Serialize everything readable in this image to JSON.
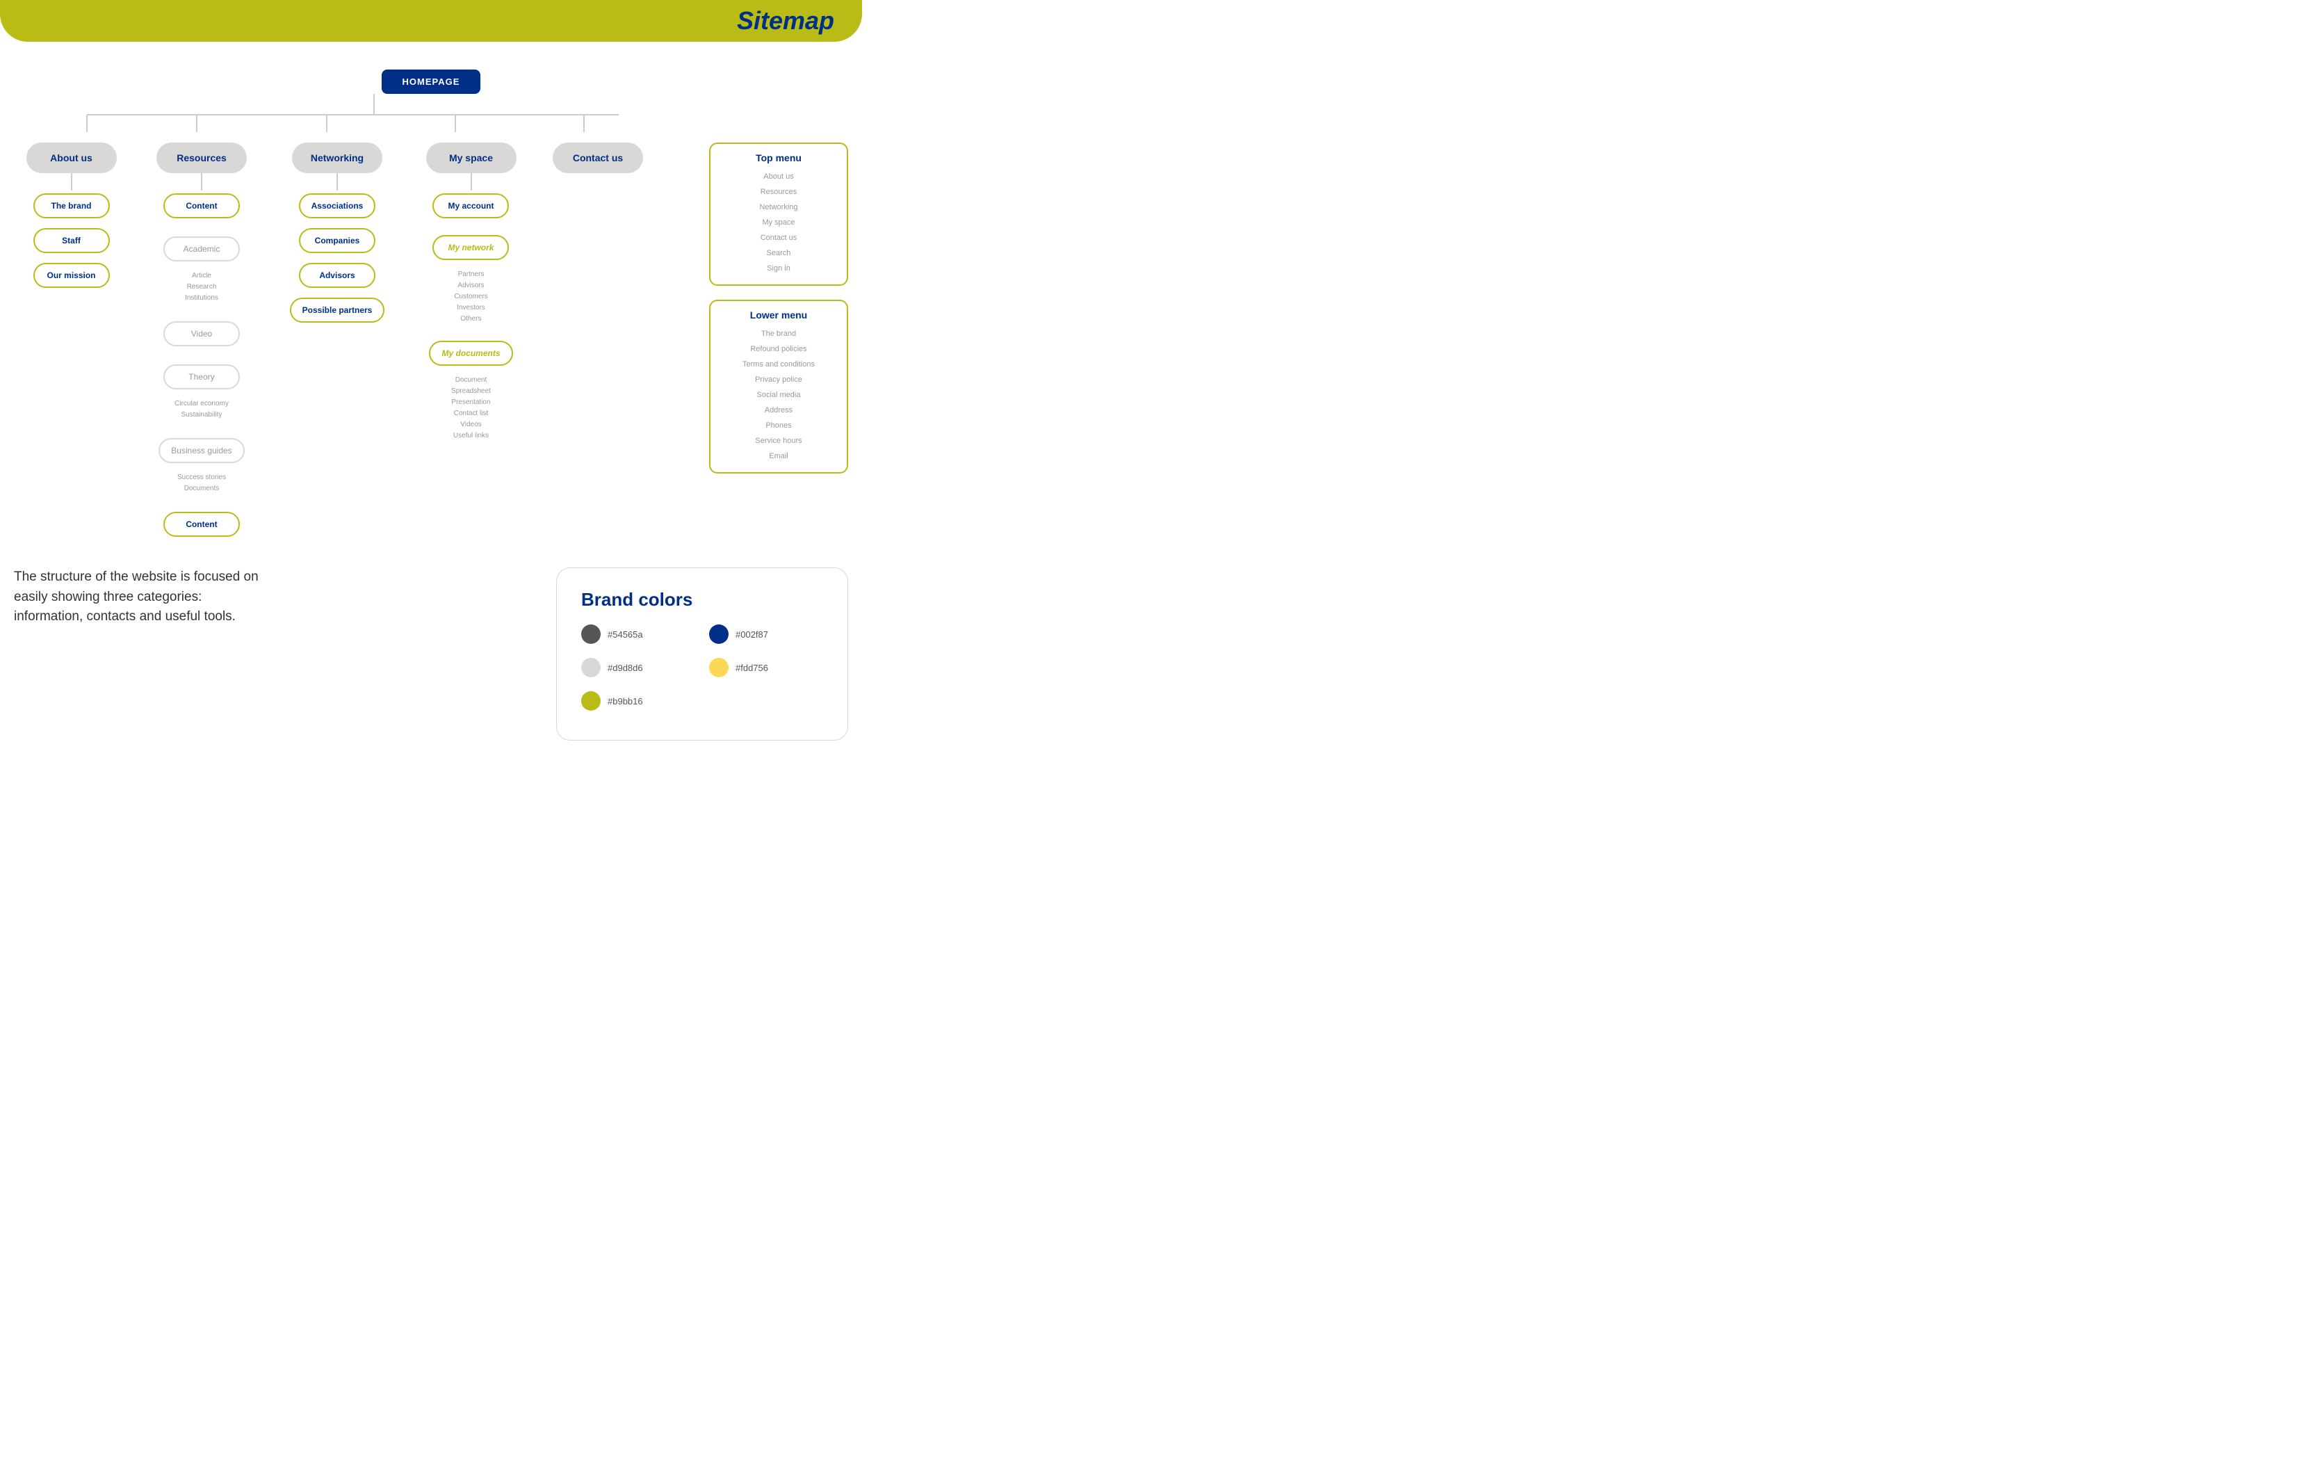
{
  "header": {
    "title": "Sitemap",
    "bar_color": "#b9bb16"
  },
  "homepage": {
    "label": "HOMEPAGE"
  },
  "categories": [
    {
      "id": "about-us",
      "label": "About us",
      "children": [
        {
          "label": "The brand",
          "type": "outlined"
        },
        {
          "label": "Staff",
          "type": "outlined"
        },
        {
          "label": "Our mission",
          "type": "outlined"
        }
      ]
    },
    {
      "id": "resources",
      "label": "Resources",
      "children": [
        {
          "label": "Content",
          "type": "outlined"
        },
        {
          "label": "Academic",
          "type": "gray",
          "sub": [
            "Article",
            "Research",
            "Institutions"
          ]
        },
        {
          "label": "Video",
          "type": "gray"
        },
        {
          "label": "Theory",
          "type": "gray",
          "sub": [
            "Circular economy",
            "Sustainability"
          ]
        },
        {
          "label": "Business guides",
          "type": "gray",
          "sub": [
            "Success stories",
            "Documents"
          ]
        },
        {
          "label": "Content",
          "type": "outlined"
        }
      ]
    },
    {
      "id": "networking",
      "label": "Networking",
      "children": [
        {
          "label": "Associations",
          "type": "outlined"
        },
        {
          "label": "Companies",
          "type": "outlined"
        },
        {
          "label": "Advisors",
          "type": "outlined"
        },
        {
          "label": "Possible partners",
          "type": "outlined"
        }
      ]
    },
    {
      "id": "my-space",
      "label": "My space",
      "children": [
        {
          "label": "My account",
          "type": "outlined"
        },
        {
          "label": "My network",
          "type": "italic",
          "sub": [
            "Partners",
            "Advisors",
            "Customers",
            "Investors",
            "Others"
          ]
        },
        {
          "label": "My documents",
          "type": "italic",
          "sub": [
            "Document",
            "Spreadsheet",
            "Presentation",
            "Contact list",
            "Videos",
            "Useful links"
          ]
        }
      ]
    },
    {
      "id": "contact-us",
      "label": "Contact us",
      "children": []
    }
  ],
  "top_menu": {
    "title": "Top menu",
    "items": [
      "About us",
      "Resources",
      "Networking",
      "My space",
      "Contact us",
      "Search",
      "Sign in"
    ]
  },
  "lower_menu": {
    "title": "Lower menu",
    "items": [
      "The brand",
      "Refound policies",
      "Terms and conditions",
      "Privacy police",
      "Social media",
      "Address",
      "Phones",
      "Service hours",
      "Email"
    ]
  },
  "brand_colors": {
    "title": "Brand colors",
    "colors": [
      {
        "hex": "#54565a",
        "label": "#54565a"
      },
      {
        "hex": "#002f87",
        "label": "#002f87"
      },
      {
        "hex": "#d9d8d6",
        "label": "#d9d8d6"
      },
      {
        "hex": "#fdd756",
        "label": "#fdd756"
      },
      {
        "hex": "#b9bb16",
        "label": "#b9bb16"
      }
    ]
  },
  "description": "The structure of the website is focused on easily showing three categories: information, contacts and useful tools."
}
